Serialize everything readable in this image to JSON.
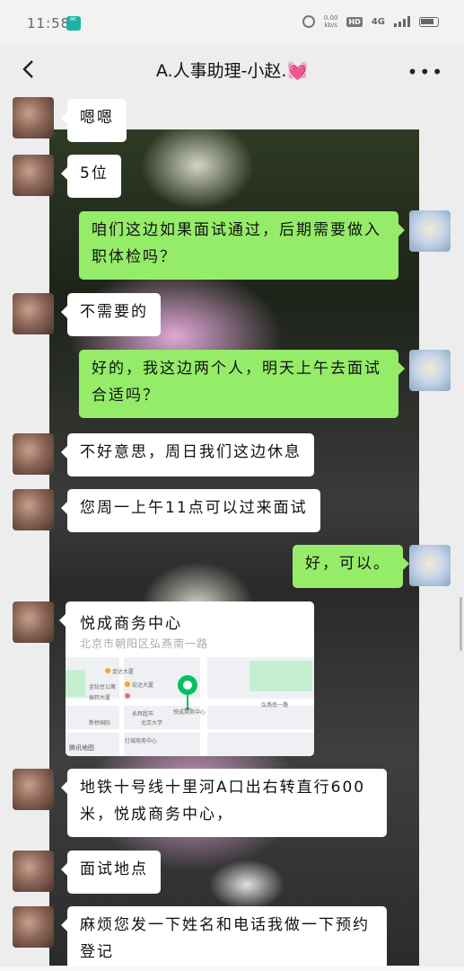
{
  "status_bar": {
    "time": "11:58",
    "speed": "0.00\nkb/s",
    "hd": "HD",
    "network": "4G"
  },
  "header": {
    "back_icon": "chevron-left-icon",
    "title": "A.人事助理-小赵.💓",
    "more_icon": "more-icon"
  },
  "messages": [
    {
      "side": "left",
      "text": "嗯嗯"
    },
    {
      "side": "left",
      "text": "5位"
    },
    {
      "side": "right",
      "text": "咱们这边如果面试通过，后期需要做入职体检吗？"
    },
    {
      "side": "left",
      "text": "不需要的"
    },
    {
      "side": "right",
      "text": "好的，我这边两个人，明天上午去面试合适吗？"
    },
    {
      "side": "left",
      "text": "不好意思，周日我们这边休息"
    },
    {
      "side": "left",
      "text": "您周一上午11点可以过来面试"
    },
    {
      "side": "right",
      "text": "好，可以。"
    },
    {
      "side": "left",
      "type": "location",
      "name": "悦成商务中心",
      "address": "北京市朝阳区弘燕南一路"
    },
    {
      "side": "left",
      "text": "地铁十号线十里河A口出右转直行600米，悦成商务中心，"
    },
    {
      "side": "left",
      "text": "面试地点"
    },
    {
      "side": "left",
      "text": "麻烦您发一下姓名和电话我做一下预约登记"
    }
  ],
  "map": {
    "labels": [
      "金达大厦",
      "宏达大厦",
      "金钻豆公寓",
      "振邦大厦",
      "永辉超市",
      "新桥国际",
      "北京大学",
      "灯城商务中心",
      "弘燕南一路",
      "悦成商务中心"
    ],
    "logo": "腾讯地图"
  }
}
